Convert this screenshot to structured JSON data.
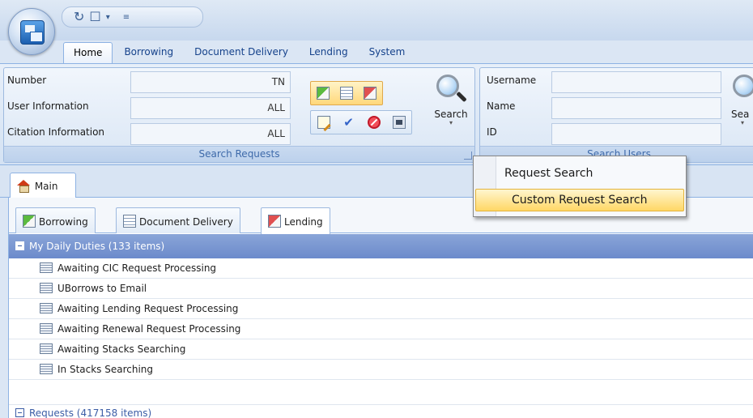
{
  "titlebar": {
    "qat_icons": [
      "refresh-icon",
      "new-window-icon",
      "dropdown-arrow-icon",
      "customize-qat-icon"
    ]
  },
  "ribbon": {
    "tabs": [
      "Home",
      "Borrowing",
      "Document Delivery",
      "Lending",
      "System"
    ],
    "active_tab": "Home",
    "search_requests": {
      "fields": [
        {
          "label": "Number",
          "value": "TN"
        },
        {
          "label": "User Information",
          "value": "ALL"
        },
        {
          "label": "Citation Information",
          "value": "ALL"
        }
      ],
      "search_label": "Search",
      "caption": "Search Requests"
    },
    "search_users": {
      "fields": [
        {
          "label": "Username",
          "value": ""
        },
        {
          "label": "Name",
          "value": ""
        },
        {
          "label": "ID",
          "value": ""
        }
      ],
      "search_label": "Sea",
      "caption": "Search Users"
    }
  },
  "context_menu": {
    "items": [
      "Request Search",
      "Custom Request Search"
    ],
    "highlighted": "Custom Request Search"
  },
  "doc_tab": {
    "label": "Main"
  },
  "sub_tabs": [
    "Borrowing",
    "Document Delivery",
    "Lending"
  ],
  "active_sub_tab": "Lending",
  "queue": {
    "group_header": "My Daily Duties  (133 items)",
    "items": [
      "Awaiting CIC Request Processing",
      "UBorrows to Email",
      "Awaiting Lending Request Processing",
      "Awaiting Renewal Request Processing",
      "Awaiting Stacks Searching",
      "In Stacks Searching"
    ],
    "requests_header": "Requests  (417158 items)"
  }
}
